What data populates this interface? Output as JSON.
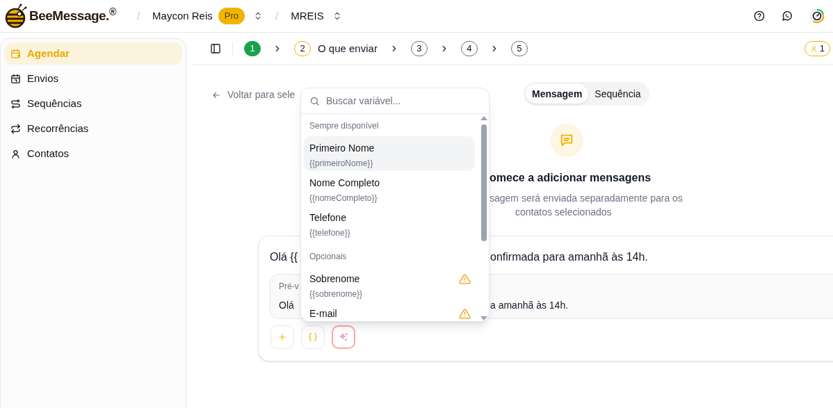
{
  "header": {
    "brand": "BeeMessage.$^{®}$",
    "breadcrumb": [
      {
        "kind": "separator",
        "text": "/"
      },
      {
        "kind": "account",
        "text": "Maycon Reis",
        "badge": "Pro"
      },
      {
        "kind": "separator",
        "text": "/"
      },
      {
        "kind": "workspace",
        "text": "MREIS"
      }
    ]
  },
  "sidebar": {
    "items": [
      {
        "label": "Agendar",
        "selected": true
      },
      {
        "label": "Envios",
        "selected": false
      },
      {
        "label": "Sequências",
        "selected": false
      },
      {
        "label": "Recorrências",
        "selected": false
      },
      {
        "label": "Contatos",
        "selected": false
      }
    ]
  },
  "steps": [
    {
      "number": "1",
      "completed": true,
      "current": false
    },
    {
      "number": "2",
      "completed": false,
      "current": true,
      "label": "O que enviar"
    },
    {
      "number": "3",
      "completed": false,
      "current": false
    },
    {
      "number": "4",
      "completed": false,
      "current": false
    },
    {
      "number": "5",
      "completed": false,
      "current": false
    }
  ],
  "contacts_badge": "1",
  "back_link": "Voltar para sele",
  "mode_tabs": [
    {
      "label": "Mensagem",
      "selected": true
    },
    {
      "label": "Sequência",
      "selected": false
    }
  ],
  "empty_state": {
    "title": "omece a adicionar mensagens",
    "description_line_1": "sagem será enviada separadamente para os",
    "description_line_2": "contatos selecionados"
  },
  "message_card": {
    "text_left": "Olá {{",
    "text_right": "onfirmada para amanhã às 14h.",
    "preview_label": "Pré-v",
    "preview_left": "Olá",
    "preview_right": "a amanhã às 14h."
  },
  "variable_menu": {
    "search_placeholder": "Buscar variável...",
    "sections": [
      {
        "title": "Sempre disponível",
        "items": [
          {
            "label": "Primeiro Nome",
            "token": "{{primeiroNome}}",
            "selected": true,
            "warning": false
          },
          {
            "label": "Nome Completo",
            "token": "{{nomeCompleto}}",
            "selected": false,
            "warning": false
          },
          {
            "label": "Telefone",
            "token": "{{telefone}}",
            "selected": false,
            "warning": false
          }
        ]
      },
      {
        "title": "Opcionais",
        "items": [
          {
            "label": "Sobrenome",
            "token": "{{sobrenome}}",
            "selected": false,
            "warning": true
          },
          {
            "label": "E-mail",
            "selected": false,
            "warning": true
          }
        ]
      }
    ]
  }
}
